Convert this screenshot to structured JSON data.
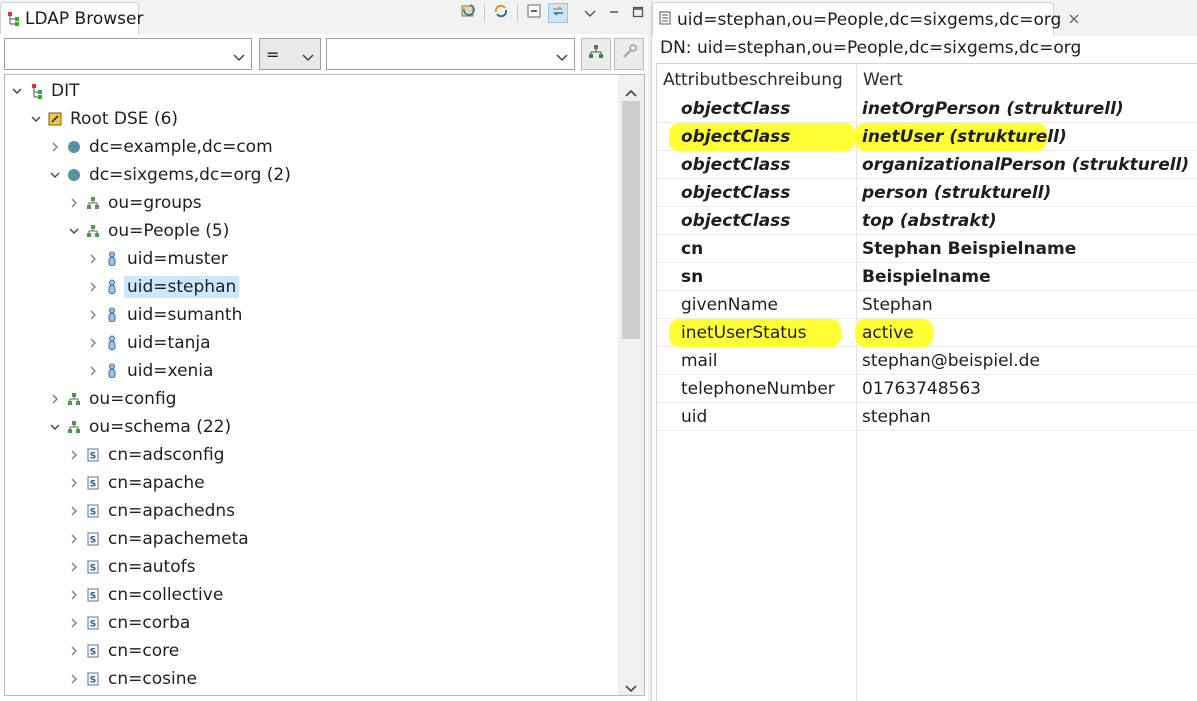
{
  "left_view": {
    "tab_title": "LDAP Browser",
    "toolbar_icons": [
      "refresh-icon",
      "link-with-editor-icon",
      "collapse-all-icon",
      "link-icon",
      "view-menu-icon",
      "minimize-icon",
      "maximize-icon"
    ],
    "filter": {
      "attribute_value": "",
      "operator_value": "=",
      "value_value": ""
    },
    "tree": [
      {
        "label": "DIT",
        "level": 0,
        "expanded": true,
        "icon": "dit-icon"
      },
      {
        "label": "Root DSE (6)",
        "level": 1,
        "expanded": true,
        "icon": "root-dse-icon"
      },
      {
        "label": "dc=example,dc=com",
        "level": 2,
        "expanded": false,
        "icon": "globe-icon"
      },
      {
        "label": "dc=sixgems,dc=org (2)",
        "level": 2,
        "expanded": true,
        "icon": "globe-icon"
      },
      {
        "label": "ou=groups",
        "level": 3,
        "expanded": false,
        "icon": "org-unit-icon"
      },
      {
        "label": "ou=People (5)",
        "level": 3,
        "expanded": true,
        "icon": "org-unit-icon"
      },
      {
        "label": "uid=muster",
        "level": 4,
        "expanded": false,
        "icon": "person-icon"
      },
      {
        "label": "uid=stephan",
        "level": 4,
        "expanded": false,
        "icon": "person-icon",
        "selected": true
      },
      {
        "label": "uid=sumanth",
        "level": 4,
        "expanded": false,
        "icon": "person-icon"
      },
      {
        "label": "uid=tanja",
        "level": 4,
        "expanded": false,
        "icon": "person-icon"
      },
      {
        "label": "uid=xenia",
        "level": 4,
        "expanded": false,
        "icon": "person-icon"
      },
      {
        "label": "ou=config",
        "level": 2,
        "expanded": false,
        "icon": "org-unit-icon"
      },
      {
        "label": "ou=schema (22)",
        "level": 2,
        "expanded": true,
        "icon": "org-unit-icon"
      },
      {
        "label": "cn=adsconfig",
        "level": 3,
        "expanded": false,
        "icon": "schema-icon"
      },
      {
        "label": "cn=apache",
        "level": 3,
        "expanded": false,
        "icon": "schema-icon"
      },
      {
        "label": "cn=apachedns",
        "level": 3,
        "expanded": false,
        "icon": "schema-icon"
      },
      {
        "label": "cn=apachemeta",
        "level": 3,
        "expanded": false,
        "icon": "schema-icon"
      },
      {
        "label": "cn=autofs",
        "level": 3,
        "expanded": false,
        "icon": "schema-icon"
      },
      {
        "label": "cn=collective",
        "level": 3,
        "expanded": false,
        "icon": "schema-icon"
      },
      {
        "label": "cn=corba",
        "level": 3,
        "expanded": false,
        "icon": "schema-icon"
      },
      {
        "label": "cn=core",
        "level": 3,
        "expanded": false,
        "icon": "schema-icon"
      },
      {
        "label": "cn=cosine",
        "level": 3,
        "expanded": false,
        "icon": "schema-icon"
      }
    ]
  },
  "right_view": {
    "tab_title": "uid=stephan,ou=People,dc=sixgems,dc=org",
    "dn_line": "DN: uid=stephan,ou=People,dc=sixgems,dc=org",
    "columns": {
      "attribute": "Attributbeschreibung",
      "value": "Wert"
    },
    "rows": [
      {
        "attr": "objectClass",
        "value": "inetOrgPerson (strukturell)",
        "style": "bold-italic",
        "highlight": false
      },
      {
        "attr": "objectClass",
        "value": "inetUser (strukturell)",
        "style": "bold-italic",
        "highlight": true
      },
      {
        "attr": "objectClass",
        "value": "organizationalPerson (strukturell)",
        "style": "bold-italic",
        "highlight": false
      },
      {
        "attr": "objectClass",
        "value": "person (strukturell)",
        "style": "bold-italic",
        "highlight": false
      },
      {
        "attr": "objectClass",
        "value": "top (abstrakt)",
        "style": "bold-italic",
        "highlight": false
      },
      {
        "attr": "cn",
        "value": "Stephan Beispielname",
        "style": "bold",
        "highlight": false
      },
      {
        "attr": "sn",
        "value": "Beispielname",
        "style": "bold",
        "highlight": false
      },
      {
        "attr": "givenName",
        "value": "Stephan",
        "style": "normal",
        "highlight": false
      },
      {
        "attr": "inetUserStatus",
        "value": "active",
        "style": "normal",
        "highlight": true
      },
      {
        "attr": "mail",
        "value": "stephan@beispiel.de",
        "style": "normal",
        "highlight": false
      },
      {
        "attr": "telephoneNumber",
        "value": "01763748563",
        "style": "normal",
        "highlight": false
      },
      {
        "attr": "uid",
        "value": "stephan",
        "style": "normal",
        "highlight": false
      }
    ]
  },
  "colors": {
    "selection": "#cce8ff",
    "highlight": "#ffff36"
  }
}
